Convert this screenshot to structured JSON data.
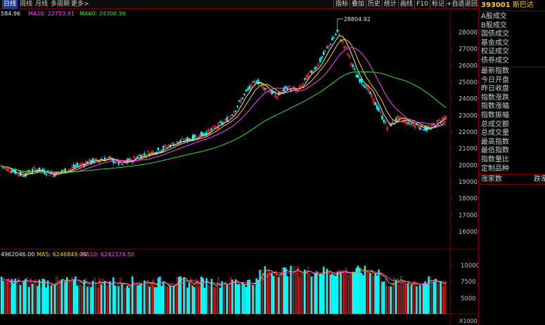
{
  "toolbar": {
    "periods": [
      "日线",
      "周线",
      "月线",
      "多周期",
      "更多>"
    ],
    "buttons": [
      "指标",
      "叠加",
      "历史",
      "统计",
      "画线",
      "F10",
      "标记",
      "+自选",
      "返回"
    ]
  },
  "ma_legend": {
    "ma5": {
      "label": "584.96",
      "color": "#e8e8e8"
    },
    "ma20": {
      "label": "MA20: 22753.91",
      "color": "#ff40ff"
    },
    "ma60": {
      "label": "MA60: 24300.56",
      "color": "#30e030"
    }
  },
  "vol_legend": {
    "vol": {
      "label": "4962046.00",
      "color": "#e8e8e8"
    },
    "ma5": {
      "label": "MA5: 6246849.00",
      "color": "#ffd000"
    },
    "ma10": {
      "label": "MA10: 6242374.50",
      "color": "#ff40ff"
    }
  },
  "peak_label": "28804.92",
  "price_axis": {
    "ticks": [
      "28000",
      "27000",
      "26000",
      "25000",
      "24000",
      "23000",
      "22000",
      "21000",
      "20000",
      "19000",
      "18000",
      "17000",
      "16000"
    ]
  },
  "vol_axis": {
    "ticks": [
      "10000",
      "7500",
      "5000"
    ],
    "unit": "X1000"
  },
  "colors": {
    "up": "#ff3030",
    "down": "#00ffff",
    "ma5": "#e8e8e8",
    "ma10": "#ffd000",
    "ma20": "#ff40ff",
    "ma60": "#30e030",
    "grid": "#7a0000"
  },
  "side_panel": {
    "code": "393001",
    "name": "斯巴达",
    "items_a": [
      "A股成交",
      "B股成交",
      "国债成交",
      "基金成交",
      "权证成交",
      "债券成交"
    ],
    "items_b": [
      "最新指数",
      "今日开盘",
      "昨日收盘",
      "指数涨跌",
      "指数涨幅",
      "指数振幅",
      "总成交额",
      "总成交量",
      "最高指数",
      "最低指数",
      "指数量比",
      "定制品种"
    ],
    "footer_left": "涨家数",
    "footer_right": "跌家"
  }
}
